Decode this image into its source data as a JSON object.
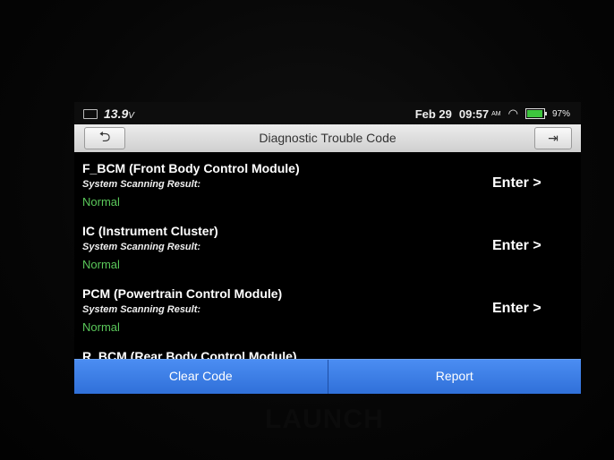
{
  "status_bar": {
    "voltage": "13.9",
    "voltage_unit": "V",
    "date": "Feb 29",
    "time": "09:57",
    "ampm": "AM",
    "battery_pct": "97%",
    "battery_level": 0.97,
    "battery_color": "#3ec53e"
  },
  "header": {
    "title": "Diagnostic Trouble Code",
    "back_icon": "back-arrow-icon",
    "exit_icon": "exit-icon"
  },
  "modules": [
    {
      "name": "F_BCM (Front Body Control Module)",
      "subtitle": "System Scanning Result:",
      "status": "Normal",
      "action": "Enter >"
    },
    {
      "name": "IC (Instrument Cluster)",
      "subtitle": "System Scanning Result:",
      "status": "Normal",
      "action": "Enter >"
    },
    {
      "name": "PCM (Powertrain Control Module)",
      "subtitle": "System Scanning Result:",
      "status": "Normal",
      "action": "Enter >"
    },
    {
      "name": "R_BCM (Rear Body Control Module)"
    }
  ],
  "footer": {
    "clear_code": "Clear Code",
    "report": "Report"
  },
  "device": {
    "brand": "LAUNCH"
  },
  "colors": {
    "accent": "#2f6fd8",
    "status_ok": "#5ac85a"
  }
}
